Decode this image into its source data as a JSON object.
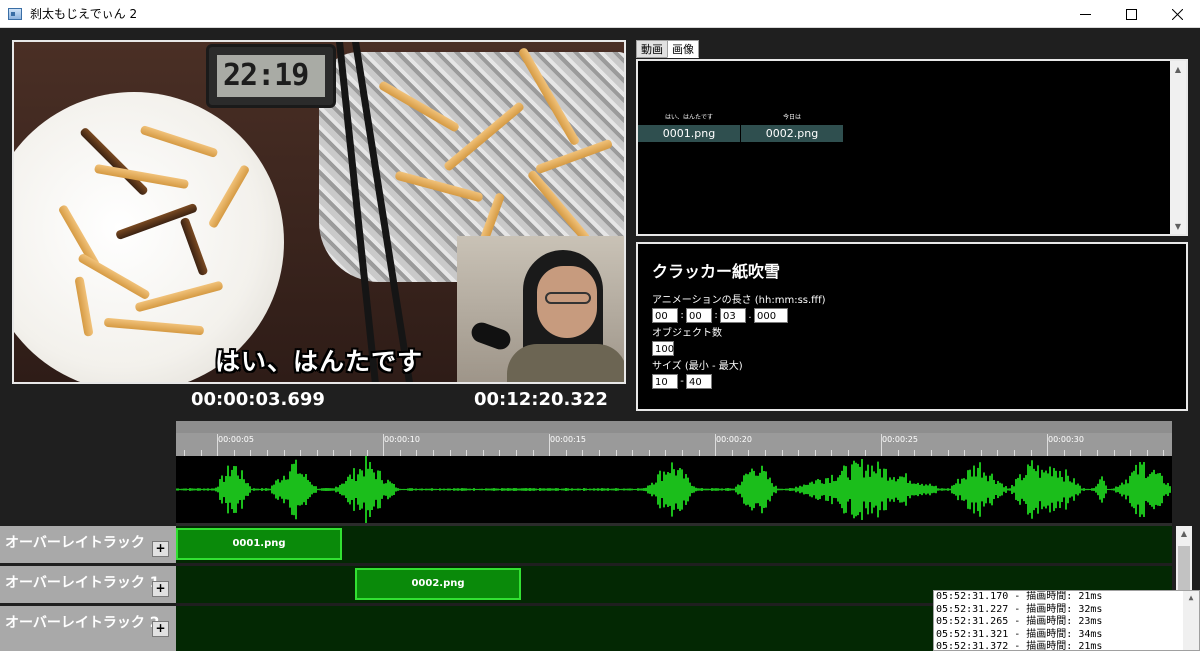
{
  "window": {
    "title": "刹太もじえでぃん 2",
    "controls": [
      "minimize",
      "maximize",
      "close"
    ]
  },
  "preview": {
    "clock_text": "22:19",
    "subtitle": "はい、はんたです",
    "current_time": "00:00:03.699",
    "total_time": "00:12:20.322"
  },
  "tabs": [
    {
      "label": "動画",
      "active": false
    },
    {
      "label": "画像",
      "active": true
    }
  ],
  "assets": [
    {
      "thumb_text": "はい、はんたです",
      "label": "0001.png"
    },
    {
      "thumb_text": "今日は",
      "label": "0002.png"
    }
  ],
  "effect": {
    "title": "クラッカー紙吹雪",
    "duration_label": "アニメーションの長さ (hh:mm:ss.fff)",
    "duration": {
      "hh": "00",
      "mm": "00",
      "ss": "03",
      "fff": "000"
    },
    "count_label": "オブジェクト数",
    "count": "100",
    "size_label": "サイズ (最小 - 最大)",
    "size_min": "10",
    "size_max": "40"
  },
  "timeline": {
    "ticks": [
      "00:00:05",
      "00:00:10",
      "00:00:15",
      "00:00:20",
      "00:00:25",
      "00:00:30"
    ],
    "waveform_color": "#22ee22"
  },
  "tracks": [
    {
      "label": "オーバーレイトラック",
      "clip": "0001.png"
    },
    {
      "label": "オーバーレイトラック 1",
      "clip": "0002.png"
    },
    {
      "label": "オーバーレイトラック 2",
      "clip": ""
    }
  ],
  "add_button": "+",
  "log": [
    "05:52:31.170 - 描画時間: 21ms",
    "05:52:31.227 - 描画時間: 32ms",
    "05:52:31.265 - 描画時間: 23ms",
    "05:52:31.321 - 描画時間: 34ms",
    "05:52:31.372 - 描画時間: 21ms"
  ],
  "colors": {
    "accent_green": "#32e132",
    "clip_fill": "#0a8a0a",
    "lane_bg": "#032803",
    "asset_selected": "#2f4f4f"
  }
}
